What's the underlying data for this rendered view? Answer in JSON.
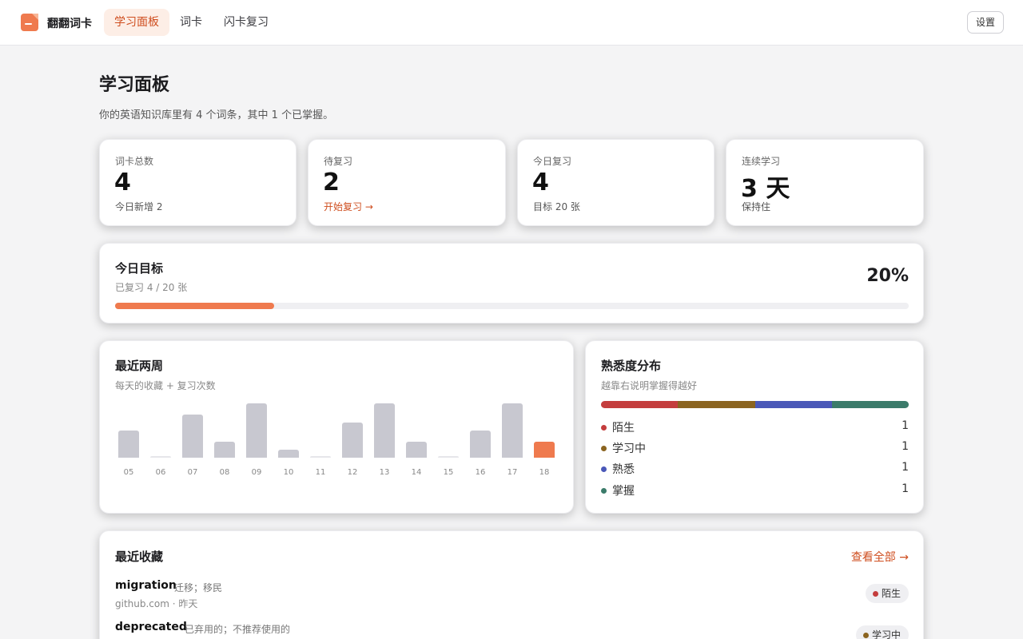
{
  "app": {
    "name": "翻翻词卡"
  },
  "nav": {
    "tabs": [
      {
        "label": "学习面板"
      },
      {
        "label": "词卡"
      },
      {
        "label": "闪卡复习"
      }
    ],
    "settings_label": "设置"
  },
  "page": {
    "title": "学习面板",
    "subtitle": "你的英语知识库里有 4 个词条，其中 1 个已掌握。"
  },
  "stats": [
    {
      "label": "词卡总数",
      "value": "4",
      "note": "今日新增 2"
    },
    {
      "label": "待复习",
      "value": "2",
      "note": "开始复习 →"
    },
    {
      "label": "今日复习",
      "value": "4",
      "note": "目标 20 张"
    },
    {
      "label": "连续学习",
      "value": "3 天",
      "note": "保持住"
    }
  ],
  "goal": {
    "title": "今日目标",
    "subtitle": "已复习 4 / 20 张",
    "percent_label": "20%",
    "progress": 0.2
  },
  "recent": {
    "title": "最近两周",
    "subtitle": "每天的收藏 + 复习次数"
  },
  "chart_data": {
    "type": "bar",
    "categories": [
      "05",
      "06",
      "07",
      "08",
      "09",
      "10",
      "11",
      "12",
      "13",
      "14",
      "15",
      "16",
      "17",
      "18"
    ],
    "values": [
      5,
      0,
      8,
      3,
      10,
      1.5,
      0,
      6.5,
      10,
      3,
      0,
      5,
      10,
      3
    ],
    "highlight_index": 13,
    "ylim": [
      0,
      10
    ],
    "grid": false,
    "colors": {
      "bar": "#c8c8d0",
      "highlight": "#ef7a4e"
    }
  },
  "familiarity": {
    "title": "熟悉度分布",
    "subtitle": "越靠右说明掌握得越好",
    "levels": [
      {
        "label": "陌生",
        "count": "1",
        "color": "#c43d3d"
      },
      {
        "label": "学习中",
        "count": "1",
        "color": "#8b6420"
      },
      {
        "label": "熟悉",
        "count": "1",
        "color": "#4a58b8"
      },
      {
        "label": "掌握",
        "count": "1",
        "color": "#3b7b6a"
      }
    ]
  },
  "saved": {
    "title": "最近收藏",
    "view_all": "查看全部 →",
    "items": [
      {
        "word": "migration",
        "meaning": "迁移；移民",
        "source": "github.com · 昨天",
        "status": "陌生",
        "status_color": "#c43d3d"
      },
      {
        "word": "deprecated",
        "meaning": "已弃用的；不推荐使用的",
        "source": "",
        "status": "学习中",
        "status_color": "#8b6420"
      }
    ]
  },
  "colors": {
    "accent": "#ef7a4e",
    "accent_text": "#cf4e1f"
  }
}
